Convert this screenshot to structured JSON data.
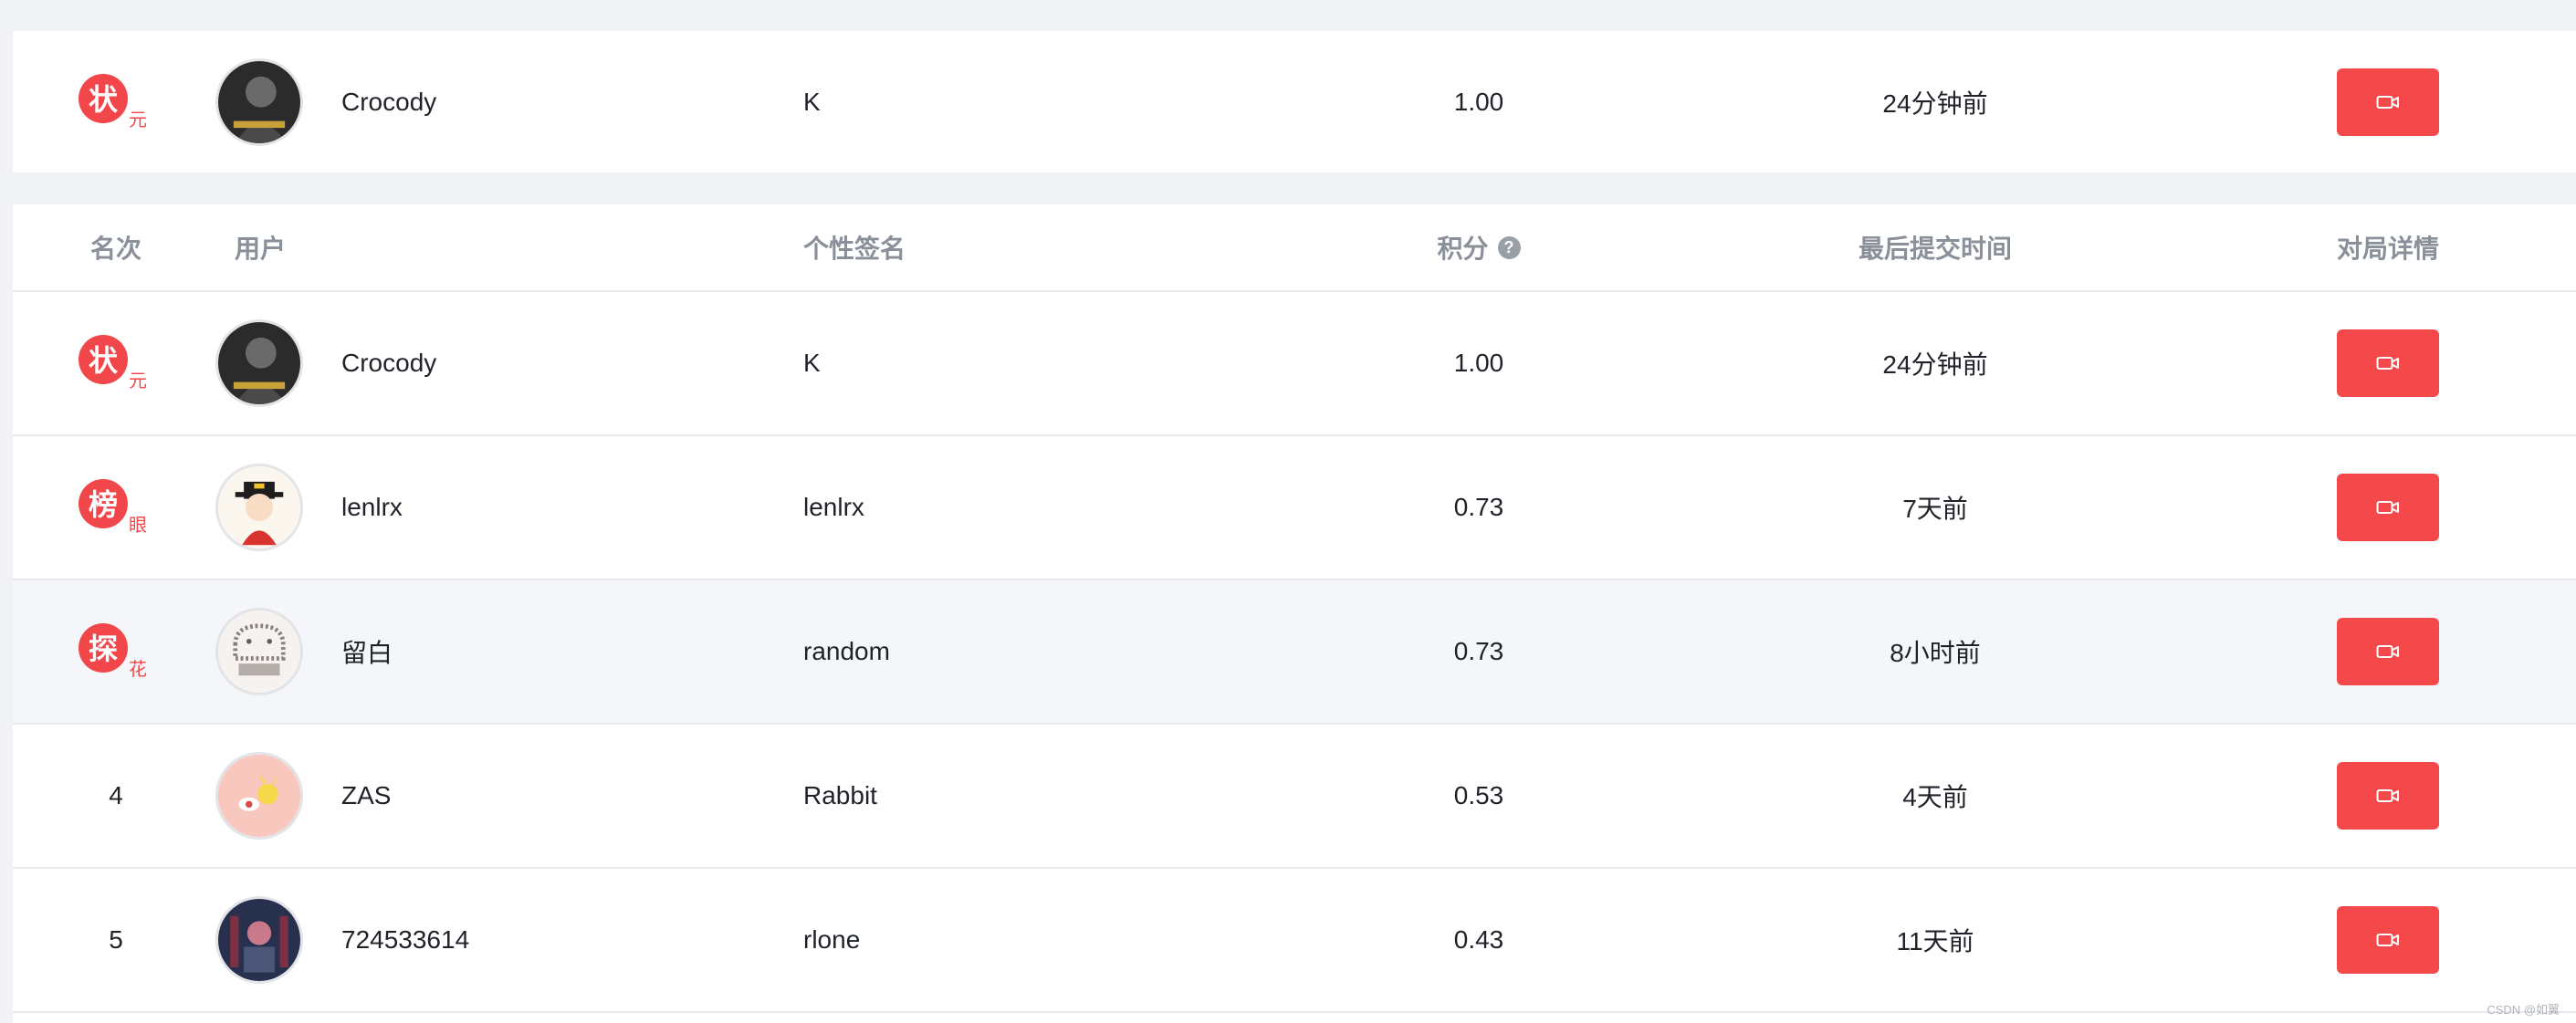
{
  "my_rank": {
    "medal": "状元",
    "medal_main": "状",
    "medal_sub": "元",
    "user": "Crocody",
    "signature": "K",
    "score": "1.00",
    "time": "24分钟前",
    "avatar": "avatar-portrait-dark"
  },
  "headers": {
    "rank": "名次",
    "user": "用户",
    "signature": "个性签名",
    "score": "积分",
    "time": "最后提交时间",
    "detail": "对局详情"
  },
  "rows": [
    {
      "medal": "状元",
      "medal_main": "状",
      "medal_sub": "元",
      "rank": "",
      "user": "Crocody",
      "signature": "K",
      "score": "1.00",
      "time": "24分钟前",
      "avatar": "avatar-portrait-dark"
    },
    {
      "medal": "榜眼",
      "medal_main": "榜",
      "medal_sub": "眼",
      "rank": "",
      "user": "lenlrx",
      "signature": "lenlrx",
      "score": "0.73",
      "time": "7天前",
      "avatar": "avatar-cartoon-official"
    },
    {
      "medal": "探花",
      "medal_main": "探",
      "medal_sub": "花",
      "rank": "",
      "user": "留白",
      "signature": "random",
      "score": "0.73",
      "time": "8小时前",
      "avatar": "avatar-pig-sketch"
    },
    {
      "medal": "",
      "rank": "4",
      "user": "ZAS",
      "signature": "Rabbit",
      "score": "0.53",
      "time": "4天前",
      "avatar": "avatar-pikachu-pink"
    },
    {
      "medal": "",
      "rank": "5",
      "user": "724533614",
      "signature": "rlone",
      "score": "0.43",
      "time": "11天前",
      "avatar": "avatar-dark-stage"
    }
  ],
  "icons": {
    "detail_button": "video-camera-icon",
    "score_help": "question-circle-icon"
  },
  "colors": {
    "accent": "#f5484a",
    "header_text": "#8a9099",
    "row_alt": "#f5f6f9",
    "background": "#f0f2f5"
  },
  "watermark": "CSDN @如翼"
}
